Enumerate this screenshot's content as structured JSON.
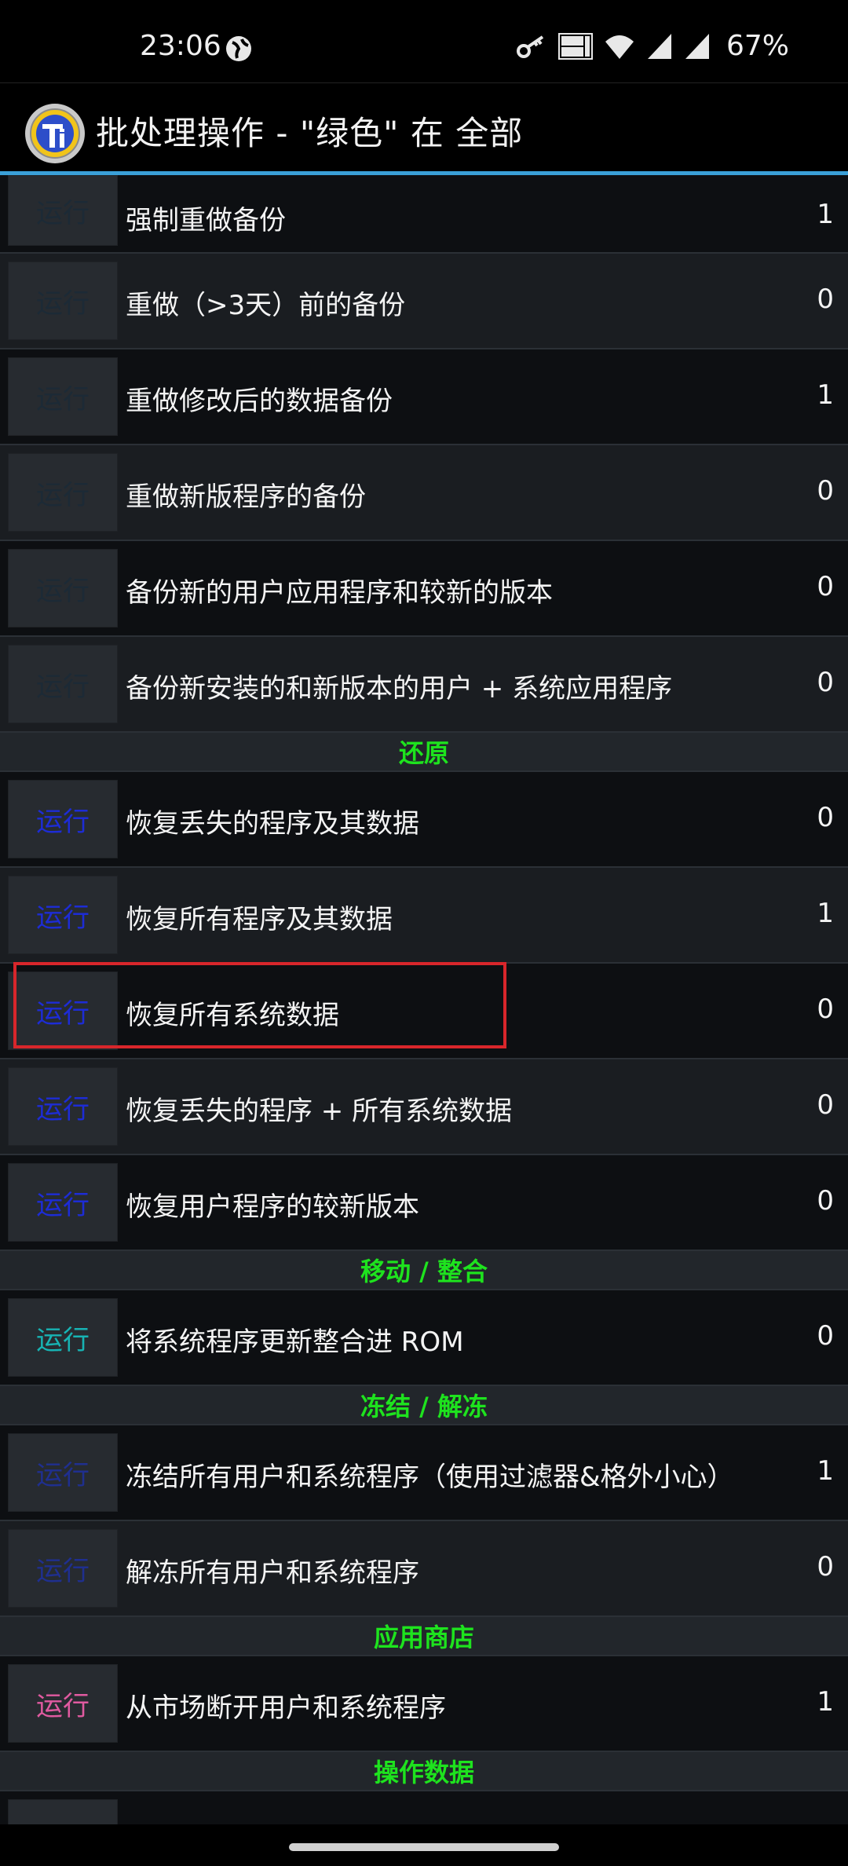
{
  "status_bar": {
    "time": "23:06",
    "battery": "67%",
    "icons": [
      "globe-icon",
      "key-icon",
      "volte-icon",
      "wifi-icon",
      "signal-icon",
      "signal-icon",
      "battery-text"
    ]
  },
  "app_bar": {
    "title": "批处理操作 - \"绿色\" 在 全部",
    "logo": "titanium-backup-logo"
  },
  "colors": {
    "accent_line": "#3aa0d8",
    "section_header_text": "#1ee31e",
    "run_dark": "#1c2a36",
    "run_blue": "#1d2cd6",
    "run_teal": "#17b3b3",
    "run_navy": "#1f2f8f",
    "run_pink": "#e05aa0",
    "highlight": "#d8262b"
  },
  "list": {
    "backup_rows": [
      {
        "run": "运行",
        "label": "强制重做备份",
        "count": "1"
      },
      {
        "run": "运行",
        "label": "重做（>3天）前的备份",
        "count": "0"
      },
      {
        "run": "运行",
        "label": "重做修改后的数据备份",
        "count": "1"
      },
      {
        "run": "运行",
        "label": "重做新版程序的备份",
        "count": "0"
      },
      {
        "run": "运行",
        "label": "备份新的用户应用程序和较新的版本",
        "count": "0"
      },
      {
        "run": "运行",
        "label": "备份新安装的和新版本的用户 + 系统应用程序",
        "count": "0"
      }
    ],
    "section_restore": "还原",
    "restore_rows": [
      {
        "run": "运行",
        "label": "恢复丢失的程序及其数据",
        "count": "0"
      },
      {
        "run": "运行",
        "label": "恢复所有程序及其数据",
        "count": "1"
      },
      {
        "run": "运行",
        "label": "恢复所有系统数据",
        "count": "0"
      },
      {
        "run": "运行",
        "label": "恢复丢失的程序 + 所有系统数据",
        "count": "0"
      },
      {
        "run": "运行",
        "label": "恢复用户程序的较新版本",
        "count": "0"
      }
    ],
    "section_move": "移动 / 整合",
    "move_rows": [
      {
        "run": "运行",
        "label": "将系统程序更新整合进 ROM",
        "count": "0"
      }
    ],
    "section_freeze": "冻结 / 解冻",
    "freeze_rows": [
      {
        "run": "运行",
        "label": "冻结所有用户和系统程序（使用过滤器&格外小心）",
        "count": "1"
      },
      {
        "run": "运行",
        "label": "解冻所有用户和系统程序",
        "count": "0"
      }
    ],
    "section_store": "应用商店",
    "store_rows": [
      {
        "run": "运行",
        "label": "从市场断开用户和系统程序",
        "count": "1"
      }
    ],
    "section_data": "操作数据"
  }
}
